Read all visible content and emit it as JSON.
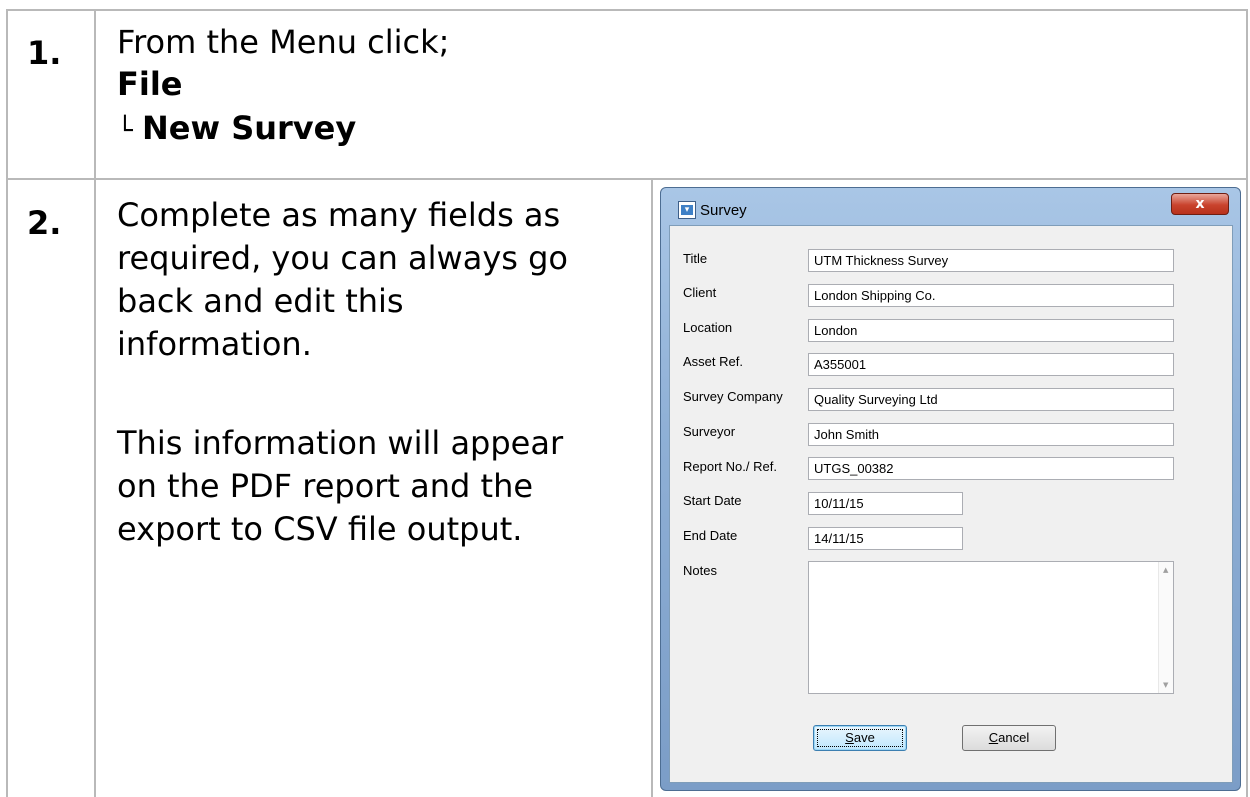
{
  "step1": {
    "number": "1.",
    "line1": "From the Menu click;",
    "line2": "File",
    "line3_prefix": "└",
    "line3": "New Survey"
  },
  "step2": {
    "number": "2.",
    "lines": [
      "Complete as many fields as",
      "required, you can always go",
      "back and edit this",
      "information.",
      "This information will appear",
      "on the PDF report and the",
      "export to CSV file output."
    ]
  },
  "dialog": {
    "title": "Survey",
    "close_label": "x",
    "fields": [
      {
        "label": "Title",
        "value": "UTM Thickness Survey"
      },
      {
        "label": "Client",
        "value": "London Shipping Co."
      },
      {
        "label": "Location",
        "value": "London"
      },
      {
        "label": "Asset Ref.",
        "value": "A355001"
      },
      {
        "label": "Survey Company",
        "value": "Quality Surveying Ltd"
      },
      {
        "label": "Surveyor",
        "value": "John Smith"
      },
      {
        "label": "Report No./ Ref.",
        "value": "UTGS_00382"
      },
      {
        "label": "Start Date",
        "value": "10/11/15"
      },
      {
        "label": "End Date",
        "value": "14/11/15"
      }
    ],
    "notes_label": "Notes",
    "notes_value": "",
    "save_label": "Save",
    "save_accesskey": "S",
    "save_rest": "ave",
    "cancel_label": "Cancel",
    "cancel_accesskey": "C",
    "cancel_rest": "ancel"
  },
  "colors": {
    "grid": "#b9b9b9",
    "dialog_frame": "#8fb0d6",
    "close_button": "#c9432d"
  }
}
